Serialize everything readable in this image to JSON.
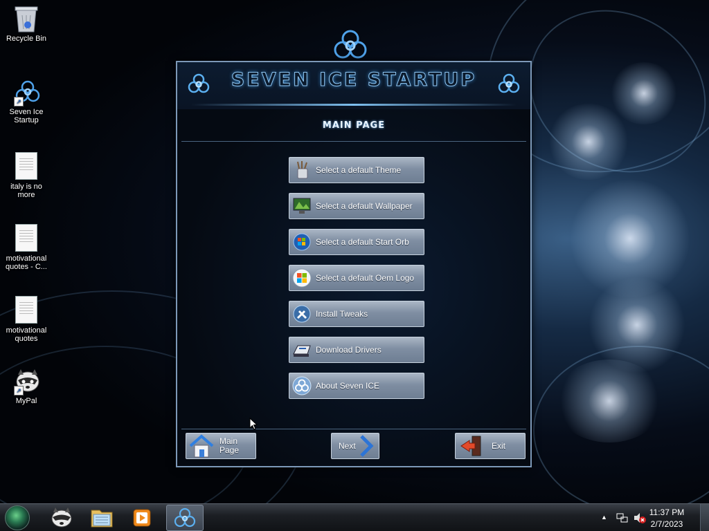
{
  "desktop": {
    "icons": [
      {
        "label": "Recycle Bin",
        "icon": "recycle-bin-icon"
      },
      {
        "label": "Seven Ice Startup",
        "icon": "biohazard-icon"
      },
      {
        "label": "italy is no more",
        "icon": "text-document-icon"
      },
      {
        "label": "motivational quotes - C...",
        "icon": "text-document-icon"
      },
      {
        "label": "motivational quotes",
        "icon": "text-document-icon"
      },
      {
        "label": "MyPal",
        "icon": "raccoon-icon"
      }
    ]
  },
  "window": {
    "title": "SEVEN ICE STARTUP",
    "page_title": "MAIN PAGE",
    "menu": [
      {
        "label": "Select a default Theme",
        "icon": "brushes-icon"
      },
      {
        "label": "Select a default Wallpaper",
        "icon": "monitor-wallpaper-icon"
      },
      {
        "label": "Select a default Start Orb",
        "icon": "windows-orb-icon"
      },
      {
        "label": "Select a default Oem Logo",
        "icon": "windows-logo-icon"
      },
      {
        "label": "Install Tweaks",
        "icon": "tools-icon"
      },
      {
        "label": "Download Drivers",
        "icon": "driver-download-icon"
      },
      {
        "label": "About Seven ICE",
        "icon": "biohazard-icon"
      }
    ],
    "nav": {
      "main_page": "Main Page",
      "next": "Next",
      "exit": "Exit"
    }
  },
  "taskbar": {
    "items": [
      "raccoon-icon",
      "explorer-folder-icon",
      "media-player-icon",
      "biohazard-icon"
    ],
    "clock_time": "11:37 PM",
    "clock_date": "2/7/2023",
    "tray_icons": [
      "show-hidden-icons-icon",
      "network-icon",
      "volume-muted-icon"
    ]
  },
  "colors": {
    "accent_glow": "#7fc0f0",
    "button_face": "#7f8ea2",
    "window_bg": "#050a12"
  }
}
